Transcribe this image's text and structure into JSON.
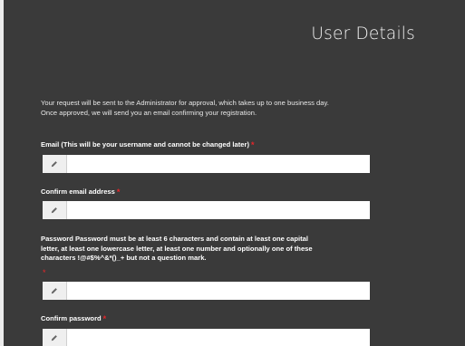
{
  "page": {
    "title": "User Details"
  },
  "intro": {
    "line1": "Your request will be sent to the Administrator for approval, which takes up to one business day.",
    "line2": "Once approved, we will send you an email confirming your registration."
  },
  "fields": {
    "email": {
      "label": "Email  (This will be your username and cannot be changed later)",
      "required_mark": "*",
      "value": "",
      "icon": "pencil-icon"
    },
    "confirm_email": {
      "label": "Confirm email address",
      "required_mark": "*",
      "value": "",
      "icon": "pencil-icon"
    },
    "password": {
      "label_line1": "Password  Password must be at least 6 characters and contain at least one capital",
      "label_line2": "letter, at least one lowercase letter, at least one number and optionally one of these",
      "label_line3": "characters !@#$%^&*()_+ but not a question mark.",
      "required_mark": "*",
      "value": "",
      "icon": "pencil-icon"
    },
    "confirm_password": {
      "label": "Confirm password",
      "required_mark": "*",
      "value": "",
      "icon": "pencil-icon"
    }
  },
  "colors": {
    "panel_bg": "#3a3a3a",
    "required": "#e8262a",
    "text": "#ffffff"
  }
}
